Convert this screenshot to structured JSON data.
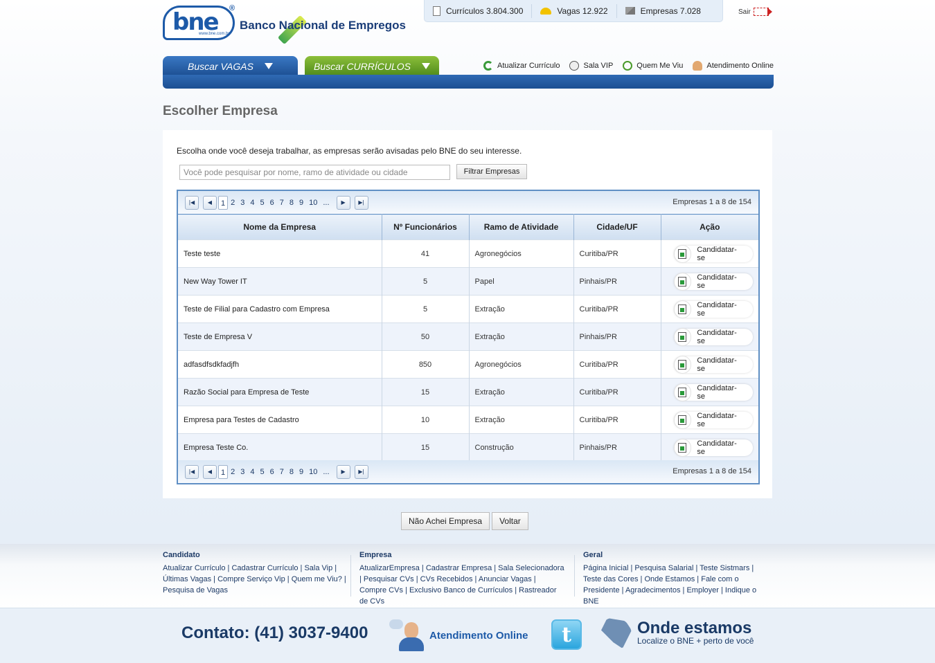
{
  "header": {
    "logo_text": "bne",
    "logo_url": "www.bne.com.br",
    "logo_reg": "®",
    "brand_name": "Banco Nacional de Empregos",
    "stats": [
      {
        "icon": "document-icon",
        "label": "Currículos 3.804.300"
      },
      {
        "icon": "helmet-icon",
        "label": "Vagas 12.922"
      },
      {
        "icon": "factory-icon",
        "label": "Empresas 7.028"
      }
    ],
    "logout_label": "Sair"
  },
  "nav": {
    "tab_vagas": "Buscar VAGAS",
    "tab_curriculos": "Buscar CURRÍCULOS",
    "links": {
      "atualizar": "Atualizar Currículo",
      "sala_vip": "Sala VIP",
      "quem_me_viu": "Quem Me Viu",
      "atendimento": "Atendimento Online"
    }
  },
  "page": {
    "title": "Escolher Empresa",
    "intro": "Escolha onde você deseja trabalhar, as empresas serão avisadas pelo BNE do seu interesse.",
    "search_placeholder": "Você pode pesquisar por nome, ramo de atividade ou cidade",
    "filter_button": "Filtrar Empresas"
  },
  "pager": {
    "pages": [
      "1",
      "2",
      "3",
      "4",
      "5",
      "6",
      "7",
      "8",
      "9",
      "10",
      "..."
    ],
    "current": "1",
    "info": "Empresas 1 a 8 de 154"
  },
  "table": {
    "columns": [
      "Nome da Empresa",
      "Nº Funcionários",
      "Ramo de Atividade",
      "Cidade/UF",
      "Ação"
    ],
    "action_label": "Candidatar-se",
    "rows": [
      {
        "name": "Teste teste",
        "employees": "41",
        "sector": "Agronegócios",
        "city": "Curitiba/PR"
      },
      {
        "name": "New Way Tower IT",
        "employees": "5",
        "sector": "Papel",
        "city": "Pinhais/PR"
      },
      {
        "name": "Teste de Filial para Cadastro com Empresa",
        "employees": "5",
        "sector": "Extração",
        "city": "Curitiba/PR"
      },
      {
        "name": "Teste de Empresa V",
        "employees": "50",
        "sector": "Extração",
        "city": "Pinhais/PR"
      },
      {
        "name": "adfasdfsdkfadjfh",
        "employees": "850",
        "sector": "Agronegócios",
        "city": "Curitiba/PR"
      },
      {
        "name": "Razão Social para Empresa de Teste",
        "employees": "15",
        "sector": "Extração",
        "city": "Curitiba/PR"
      },
      {
        "name": "Empresa para Testes de Cadastro",
        "employees": "10",
        "sector": "Extração",
        "city": "Curitiba/PR"
      },
      {
        "name": "Empresa Teste Co.",
        "employees": "15",
        "sector": "Construção",
        "city": "Pinhais/PR"
      }
    ]
  },
  "buttons": {
    "nao_achei": "Não Achei Empresa",
    "voltar": "Voltar"
  },
  "footer": {
    "cols": [
      {
        "title": "Candidato",
        "links": [
          "Atualizar Currículo",
          "Cadastrar Currículo",
          "Sala Vip",
          "Últimas Vagas",
          "Compre Serviço Vip",
          "Quem me Viu?",
          "Pesquisa de Vagas"
        ]
      },
      {
        "title": "Empresa",
        "links": [
          "AtualizarEmpresa",
          "Cadastrar Empresa",
          "Sala Selecionadora",
          "Pesquisar CVs",
          "CVs Recebidos",
          "Anunciar Vagas",
          "Compre CVs",
          "Exclusivo Banco de Currículos",
          "Rastreador de CVs"
        ]
      },
      {
        "title": "Geral",
        "links": [
          "Página Inicial",
          "Pesquisa Salarial",
          "Teste Sistmars",
          "Teste das Cores",
          "Onde Estamos",
          "Fale com o Presidente",
          "Agradecimentos",
          "Employer",
          "Indique o BNE"
        ]
      }
    ],
    "contact": "Contato: (41) 3037-9400",
    "atendimento": "Atendimento Online",
    "twitter_letter": "t",
    "onde_title": "Onde estamos",
    "onde_sub": "Localize o BNE + perto de você"
  },
  "colors": {
    "primary_blue": "#1c4f92",
    "green_tab": "#5a9a22",
    "grid_border": "#5f8fc4"
  }
}
